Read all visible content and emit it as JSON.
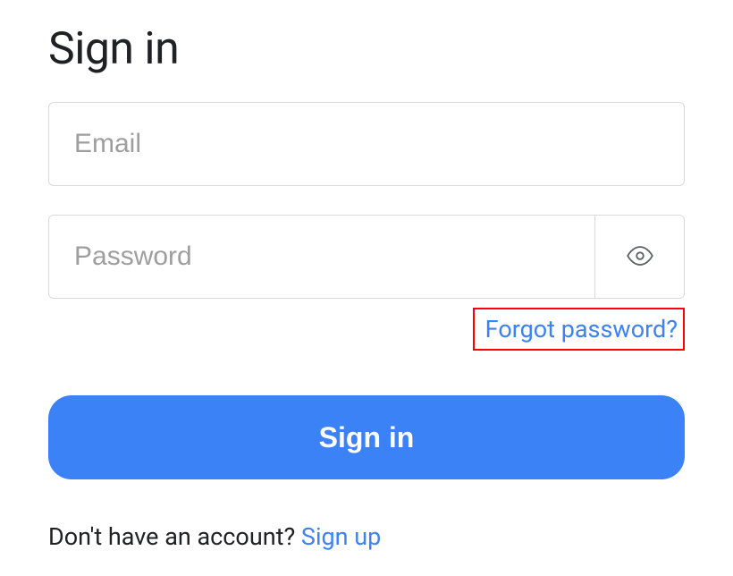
{
  "title": "Sign in",
  "email": {
    "placeholder": "Email",
    "value": ""
  },
  "password": {
    "placeholder": "Password",
    "value": ""
  },
  "forgot_label": "Forgot password?",
  "submit_label": "Sign in",
  "signup_prompt": "Don't have an account? ",
  "signup_link": "Sign up",
  "colors": {
    "accent": "#3b82f6",
    "highlight_border": "#ff0000"
  }
}
